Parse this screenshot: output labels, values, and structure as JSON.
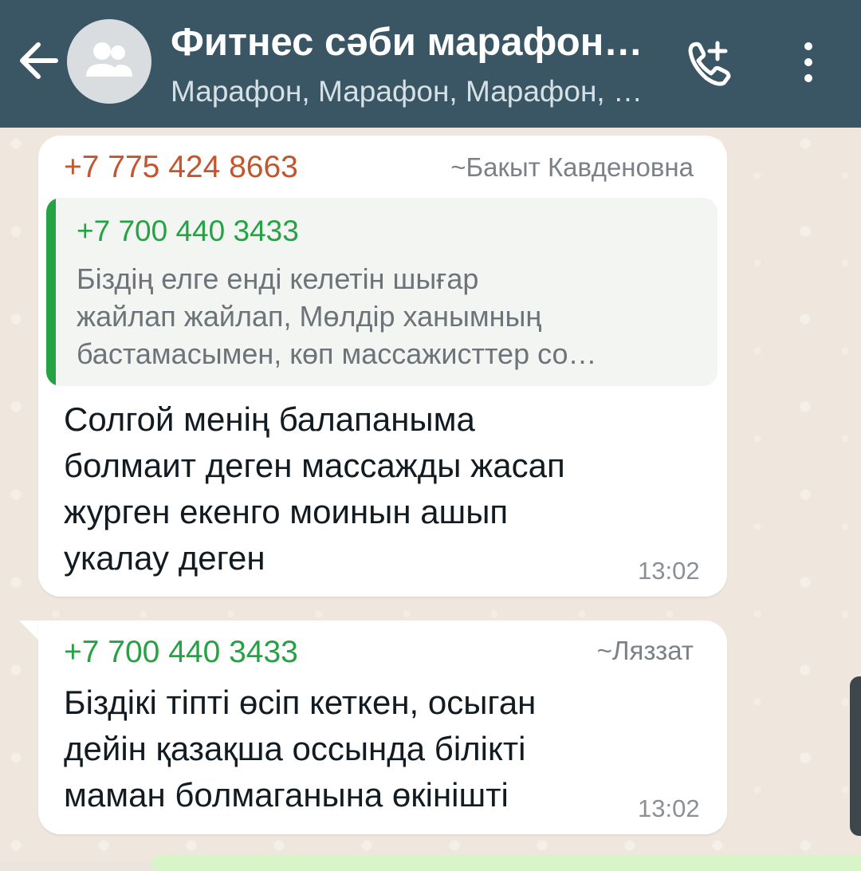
{
  "header": {
    "title": "Фитнес сәби марафон…",
    "subtitle": "Марафон, Марафон, Марафон, …",
    "icons": {
      "back": "arrow-left-icon",
      "avatar": "group-avatar-icon",
      "call": "add-call-icon",
      "menu": "more-vertical-icon"
    }
  },
  "messages": [
    {
      "phone": "+7 775 424 8663",
      "name": "~Бакыт Кавденовна",
      "phone_color": "#c4552d",
      "quote": {
        "phone": "+7 700 440 3433",
        "text": "Біздің елге енді келетін шығар\nжайлап жайлап, Мөлдір ханымның\nбастамасымен, көп массажисттер со…"
      },
      "text": "Солгой менің балапаныма\nболмаит деген массажды жасап\nжурген екенго моинын ашып\nукалау деген",
      "time": "13:02"
    },
    {
      "phone": "+7 700 440 3433",
      "name": "~Ляззат",
      "phone_color": "#25a244",
      "text": "Біздікі тіпті өсіп кеткен, осыган\nдейін қазақша оссында білікті\nмаман болмаганына өкінішті",
      "time": "13:02"
    }
  ],
  "colors": {
    "header_bg": "#3a5664",
    "chat_bg": "#efe7de",
    "bubble_bg": "#ffffff",
    "quote_accent": "#25a244"
  }
}
